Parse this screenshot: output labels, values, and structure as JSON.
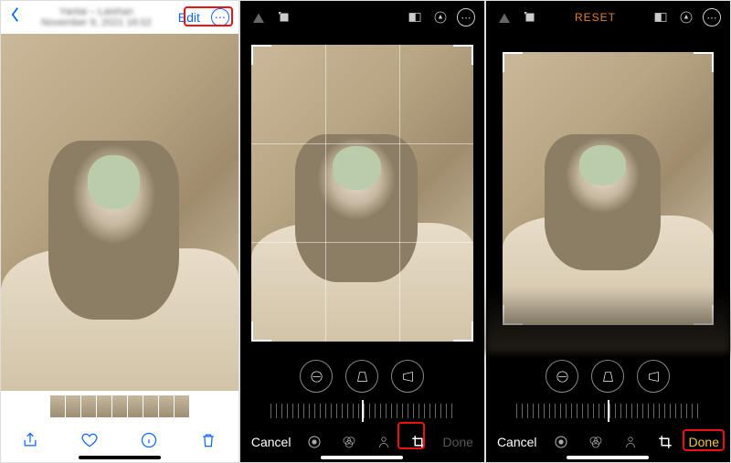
{
  "panel1": {
    "title_line1": "Yantai – Laishan",
    "title_line2": "November 9, 2021 16:02",
    "edit_label": "Edit",
    "thumb_count": 9
  },
  "panel2": {
    "cancel_label": "Cancel",
    "done_label": "Done"
  },
  "panel3": {
    "reset_label": "RESET",
    "cancel_label": "Cancel",
    "done_label": "Done"
  }
}
